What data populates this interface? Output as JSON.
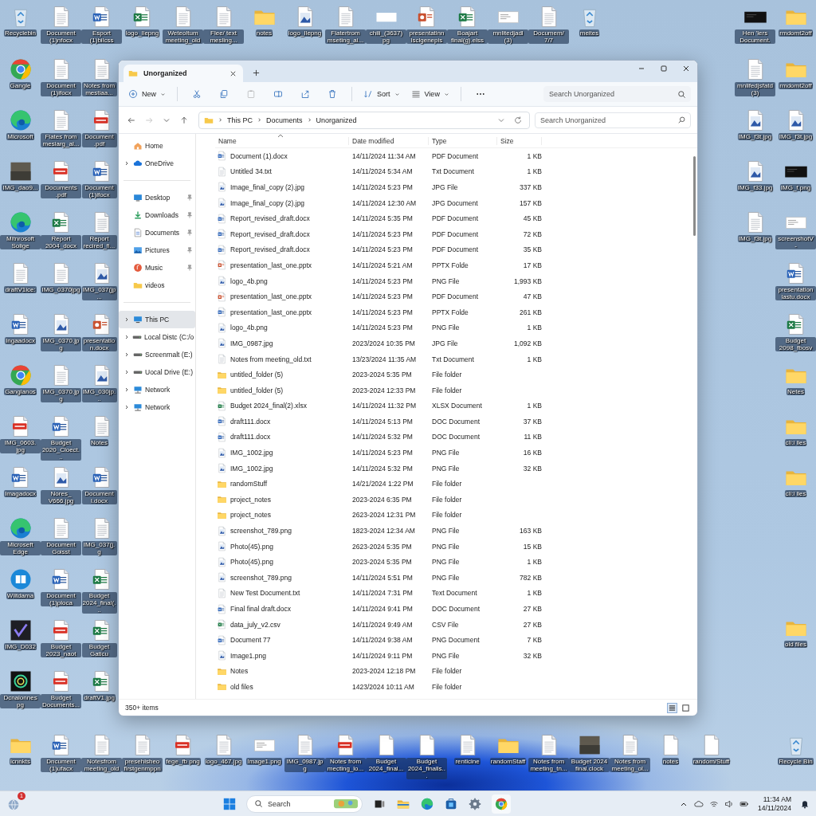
{
  "desktop": {
    "top_row_left": [
      {
        "label": "Recyclebin",
        "kind": "recycle"
      },
      {
        "label": "Document (1)nfocx",
        "kind": "doc"
      },
      {
        "label": "Esport (1)bilcss",
        "kind": "word"
      },
      {
        "label": "logo_Ilepng",
        "kind": "excel"
      },
      {
        "label": "Weteoltum meeting_old",
        "kind": "doc"
      },
      {
        "label": "Flee/ text mesling...",
        "kind": "doc"
      },
      {
        "label": "notes",
        "kind": "folder"
      },
      {
        "label": "logo_Ilepng",
        "kind": "image"
      },
      {
        "label": "Flatertrom mseting_ai...",
        "kind": "doc"
      },
      {
        "label": "chili_(3637) pg",
        "kind": "blank"
      },
      {
        "label": "presentatinn lsclgenepis",
        "kind": "ppt"
      },
      {
        "label": "Boajart final(g).elss",
        "kind": "excel"
      },
      {
        "label": "mnlitedjadl (3)",
        "kind": "shot"
      },
      {
        "label": "Documem/ 7/7",
        "kind": "doc"
      },
      {
        "label": "meites",
        "kind": "recycle"
      }
    ],
    "top_row_right": [
      {
        "label": "Hen 'lers Document.",
        "kind": "dark"
      },
      {
        "label": "rmdomt2off",
        "kind": "folder"
      }
    ],
    "left_columns": [
      [
        {
          "label": "Gangle",
          "kind": "chrome"
        },
        {
          "label": "Microsoft",
          "kind": "edge"
        },
        {
          "label": "IMG_dao9...",
          "kind": "photo"
        },
        {
          "label": "Mitnrosoft Solige",
          "kind": "edge"
        },
        {
          "label": "draftV1ice:",
          "kind": "doc"
        },
        {
          "label": "Ingaadocx",
          "kind": "word"
        },
        {
          "label": "Ganglanos",
          "kind": "chrome"
        },
        {
          "label": "IMG_0603. jpg",
          "kind": "pdf"
        },
        {
          "label": "Imagadocx",
          "kind": "word"
        },
        {
          "label": "Microseft Edge",
          "kind": "edge"
        },
        {
          "label": "Wiitdama",
          "kind": "app"
        },
        {
          "label": "IMG_D032",
          "kind": "check"
        },
        {
          "label": "Dcnaionnes pg",
          "kind": "ring"
        }
      ],
      [
        {
          "label": "Document (1)ifocx",
          "kind": "doc"
        },
        {
          "label": "Flates from mesiarg_al...",
          "kind": "doc"
        },
        {
          "label": "Documents .pdf",
          "kind": "pdf"
        },
        {
          "label": "Report 2004_docx",
          "kind": "excel"
        },
        {
          "label": "IMG_0370jpg",
          "kind": "doc"
        },
        {
          "label": "IMG_0370.jpg",
          "kind": "image"
        },
        {
          "label": "IMG_0370.jpg",
          "kind": "doc"
        },
        {
          "label": "Budget 2020_Cloect...",
          "kind": "word"
        },
        {
          "label": "Nores_ V666.jpg",
          "kind": "image"
        },
        {
          "label": "Document Goisst",
          "kind": "doc"
        },
        {
          "label": "Document (1)ploca",
          "kind": "word"
        },
        {
          "label": "Budget 2023_naot",
          "kind": "pdf"
        },
        {
          "label": "Budget Documents...",
          "kind": "pdf"
        }
      ],
      [
        {
          "label": "Notes from mestiaa...",
          "kind": "doc"
        },
        {
          "label": "Document .pdf",
          "kind": "pdf"
        },
        {
          "label": "Document (1)ifocx",
          "kind": "word"
        },
        {
          "label": "Report recired_fi...",
          "kind": "doc"
        },
        {
          "label": "IMG_037(jp...",
          "kind": "image"
        },
        {
          "label": "presentatio n.docx",
          "kind": "ppt"
        },
        {
          "label": "IMG_030jp...",
          "kind": "image"
        },
        {
          "label": "Notes",
          "kind": "doc"
        },
        {
          "label": "Document l.docx",
          "kind": "word"
        },
        {
          "label": "IMG_037(j.g",
          "kind": "doc"
        },
        {
          "label": "Budget 2024_final(...",
          "kind": "excel"
        },
        {
          "label": "Budget Gaticu",
          "kind": "excel"
        },
        {
          "label": "draftV1.jpg",
          "kind": "excel"
        }
      ]
    ],
    "right_columns": [
      [
        {
          "label": "mnlifedjsfatd (3)",
          "kind": "doc"
        },
        {
          "label": "IMG_f3t.jpg",
          "kind": "image"
        },
        {
          "label": "IMG_f33.jpg",
          "kind": "image"
        },
        {
          "label": "IMG_f3t.jpg",
          "kind": "doc"
        }
      ],
      [
        {
          "label": "rmdomt2off",
          "kind": "folder"
        },
        {
          "label": "IMG_f3t.jpg",
          "kind": "image"
        },
        {
          "label": "IMG_f.png",
          "kind": "dark"
        },
        {
          "label": "screenshotV -",
          "kind": "shot"
        },
        {
          "label": "presentation lastu.docx",
          "kind": "word"
        },
        {
          "label": "Budget 2098_fbosv",
          "kind": "excel"
        },
        {
          "label": "Netes",
          "kind": "folder"
        },
        {
          "label": "cli:i lles",
          "kind": "folder"
        },
        {
          "label": "cli:i lles",
          "kind": "folder"
        },
        {
          "label": "old files",
          "kind": "folder"
        }
      ]
    ],
    "bottom_row_left": [
      {
        "label": "icnnkts",
        "kind": "folder"
      },
      {
        "label": "Dncument (1)ufacx",
        "kind": "word"
      },
      {
        "label": "Notesfrom meeting_old",
        "kind": "doc"
      },
      {
        "label": "presehisheo firstgenmppn",
        "kind": "doc"
      },
      {
        "label": "fege_fb png",
        "kind": "pdf"
      },
      {
        "label": "logo_467.jpg",
        "kind": "doc"
      },
      {
        "label": "Image1.png",
        "kind": "shot"
      },
      {
        "label": "IMG_0987.jpg",
        "kind": "doc"
      },
      {
        "label": "Notes from mecting_lo...",
        "kind": "pdf"
      },
      {
        "label": "Budget 2024_final...",
        "kind": "blankdoc"
      },
      {
        "label": "Budget 2024_finalls...",
        "kind": "blankdoc"
      },
      {
        "label": "renticine",
        "kind": "doc"
      },
      {
        "label": "randomStaff",
        "kind": "folder"
      },
      {
        "label": "Notes from meeting_tn...",
        "kind": "doc"
      },
      {
        "label": "Budget 2024 final.clock",
        "kind": "photo"
      },
      {
        "label": "Notes from meeting_ol...",
        "kind": "doc"
      },
      {
        "label": "notes",
        "kind": "blankdoc"
      },
      {
        "label": "random/Stuff",
        "kind": "blankdoc"
      }
    ],
    "bottom_row_right": [
      {
        "label": "Recycle Bin",
        "kind": "recycle"
      }
    ]
  },
  "window": {
    "tab": "Unorganized",
    "toolbar": {
      "new": "New",
      "sort": "Sort",
      "view": "View",
      "search_placeholder": "Search Unorganized"
    },
    "breadcrumb": [
      "This PC",
      "Documents",
      "Unorganized"
    ],
    "address_search_placeholder": "Search Unorganized",
    "sidebar": [
      [
        {
          "label": "Home",
          "kind": "home",
          "expandable": false,
          "pinned": false,
          "selected": false
        },
        {
          "label": "OneDrive",
          "kind": "cloud",
          "expandable": true,
          "pinned": false,
          "selected": false
        }
      ],
      [
        {
          "label": "Desktop",
          "kind": "desktop",
          "expandable": false,
          "pinned": true,
          "selected": false
        },
        {
          "label": "Downloads",
          "kind": "downloads",
          "expandable": false,
          "pinned": true,
          "selected": false
        },
        {
          "label": "Documents",
          "kind": "documents",
          "expandable": false,
          "pinned": true,
          "selected": false
        },
        {
          "label": "Pictures",
          "kind": "pictures",
          "expandable": false,
          "pinned": true,
          "selected": false
        },
        {
          "label": "Music",
          "kind": "music",
          "expandable": false,
          "pinned": true,
          "selected": false
        },
        {
          "label": "videos",
          "kind": "folder",
          "expandable": false,
          "pinned": false,
          "selected": false
        }
      ],
      [
        {
          "label": "This PC",
          "kind": "pc",
          "expandable": true,
          "pinned": false,
          "selected": true
        },
        {
          "label": "Local Distc (C:/o",
          "kind": "drive",
          "expandable": true,
          "pinned": false,
          "selected": false
        },
        {
          "label": "Screenrnalt (E:)",
          "kind": "drive",
          "expandable": true,
          "pinned": false,
          "selected": false
        },
        {
          "label": "Uocal Drive (E:)",
          "kind": "drive",
          "expandable": true,
          "pinned": false,
          "selected": false
        },
        {
          "label": "Network",
          "kind": "network",
          "expandable": true,
          "pinned": false,
          "selected": false
        },
        {
          "label": "Network",
          "kind": "network",
          "expandable": true,
          "pinned": false,
          "selected": false
        }
      ]
    ],
    "columns": [
      "Name",
      "Date modified",
      "Type",
      "Size"
    ],
    "rows": [
      {
        "name": "Document (1).docx",
        "date": "14/11/2024 11:34 AM",
        "type": "PDF Document",
        "size": "1 KB",
        "kind": "word"
      },
      {
        "name": "Untitled 34.txt",
        "date": "14/11/2024 5:34 AM",
        "type": "Txt Document",
        "size": "1 KB",
        "kind": "txt"
      },
      {
        "name": "Image_final_copy (2).jpg",
        "date": "14/11/2024 5:23 PM",
        "type": "JPG File",
        "size": "337 KB",
        "kind": "image"
      },
      {
        "name": "Image_final_copy (2).jpg",
        "date": "14/11/2024 12:30 AM",
        "type": "JPG Document",
        "size": "157 KB",
        "kind": "image"
      },
      {
        "name": "Report_revised_draft.docx",
        "date": "14/11/2024 5:35 PM",
        "type": "PDF Document",
        "size": "45 KB",
        "kind": "word"
      },
      {
        "name": "Report_revised_draft.docx",
        "date": "14/11/2024 5:23 PM",
        "type": "PDF Document",
        "size": "72 KB",
        "kind": "word"
      },
      {
        "name": "Report_revised_draft.docx",
        "date": "14/11/2024 5:23 PM",
        "type": "PDF Document",
        "size": "35 KB",
        "kind": "word"
      },
      {
        "name": "presentation_last_one.pptx",
        "date": "14/11/2024 5:21 AM",
        "type": "PPTX Folde",
        "size": "17 KB",
        "kind": "ppt"
      },
      {
        "name": "logo_4b.png",
        "date": "14/11/2024 5:23 PM",
        "type": "PNG File",
        "size": "1,993 KB",
        "kind": "image"
      },
      {
        "name": "presentation_last_one.pptx",
        "date": "14/11/2024 5:23 PM",
        "type": "PDF Document",
        "size": "47 KB",
        "kind": "ppt"
      },
      {
        "name": "presentation_last_one.pptx",
        "date": "14/11/2024 5:23 PM",
        "type": "PPTX Folde",
        "size": "261 KB",
        "kind": "word"
      },
      {
        "name": "logo_4b.png",
        "date": "14/11/2024 5:23 PM",
        "type": "PNG File",
        "size": "1 KB",
        "kind": "image"
      },
      {
        "name": "IMG_0987.jpg",
        "date": "2023/2024 10:35 PM",
        "type": "JPG File",
        "size": "1,092 KB",
        "kind": "image"
      },
      {
        "name": "Notes from meeting_old.txt",
        "date": "13/23/2024 11:35 AM",
        "type": "Txt Document",
        "size": "1 KB",
        "kind": "txt"
      },
      {
        "name": "untitled_folder (5)",
        "date": "2023-2024 5:35 PM",
        "type": "File folder",
        "kind": "folder"
      },
      {
        "name": "untitled_folder (5)",
        "date": "2023-2024 12:33 PM",
        "type": "File folder",
        "kind": "folder"
      },
      {
        "name": "Budget 2024_final(2).xlsx",
        "date": "14/11/2024 11:32 PM",
        "type": "XLSX Document",
        "size": "1 KB",
        "kind": "excel"
      },
      {
        "name": "draft111.docx",
        "date": "14/11/2024 5:13 PM",
        "type": "DOC Document",
        "size": "37 KB",
        "kind": "word"
      },
      {
        "name": "draft111.docx",
        "date": "14/11/2024 5:32 PM",
        "type": "DOC Document",
        "size": "11 KB",
        "kind": "word"
      },
      {
        "name": "IMG_1002.jpg",
        "date": "14/11/2024 5:23 PM",
        "type": "PNG File",
        "size": "16 KB",
        "kind": "image"
      },
      {
        "name": "IMG_1002.jpg",
        "date": "14/11/2024 5:32 PM",
        "type": "PNG File",
        "size": "32 KB",
        "kind": "image"
      },
      {
        "name": "randomStuff",
        "date": "14/21/2024 1:22 PM",
        "type": "File folder",
        "kind": "folder"
      },
      {
        "name": "project_notes",
        "date": "2023-2024 6:35 PM",
        "type": "File folder",
        "kind": "folder"
      },
      {
        "name": "project_notes",
        "date": "2623-2024 12:31 PM",
        "type": "File folder",
        "kind": "folder"
      },
      {
        "name": "screenshot_789.png",
        "date": "1823-2024 12:34 AM",
        "type": "PNG File",
        "size": "163 KB",
        "kind": "image"
      },
      {
        "name": "Photo(45).png",
        "date": "2623-2024 5:35 PM",
        "type": "PNG File",
        "size": "15 KB",
        "kind": "image"
      },
      {
        "name": "Photo(45).png",
        "date": "2023-2024 5:35 PM",
        "type": "PNG File",
        "size": "1 KB",
        "kind": "image"
      },
      {
        "name": "screenshot_789.png",
        "date": "14/11/2024 5:51 PM",
        "type": "PNG File",
        "size": "782 KB",
        "kind": "image"
      },
      {
        "name": "New Test Document.txt",
        "date": "14/11/2024 7:31 PM",
        "type": "Text Document",
        "size": "1 KB",
        "kind": "txt"
      },
      {
        "name": "Final final draft.docx",
        "date": "14/11/2024 9:41 PM",
        "type": "DOC Document",
        "size": "27 KB",
        "kind": "word"
      },
      {
        "name": "data_july_v2.csv",
        "date": "14/11/2024 9:49 AM",
        "type": "CSV File",
        "size": "27 KB",
        "kind": "excel"
      },
      {
        "name": "Document 77",
        "date": "14/11/2024 9:38 AM",
        "type": "PNG Document",
        "size": "7 KB",
        "kind": "word"
      },
      {
        "name": "Image1.png",
        "date": "14/11/2024 9:11 PM",
        "type": "PNG File",
        "size": "32 KB",
        "kind": "image"
      },
      {
        "name": "Notes",
        "date": "2023-2024 12:18 PM",
        "type": "File folder",
        "kind": "folder"
      },
      {
        "name": "old files",
        "date": "1423/2024 10:11 AM",
        "type": "File folder",
        "kind": "folder"
      }
    ],
    "status": "350+ items",
    "views": [
      {
        "kind": "details",
        "selected": true
      },
      {
        "kind": "tiles",
        "selected": false
      }
    ]
  },
  "taskbar": {
    "notification_count": "1",
    "search_placeholder": "Search",
    "time": "11:34 AM",
    "date": "14/11/2024"
  }
}
